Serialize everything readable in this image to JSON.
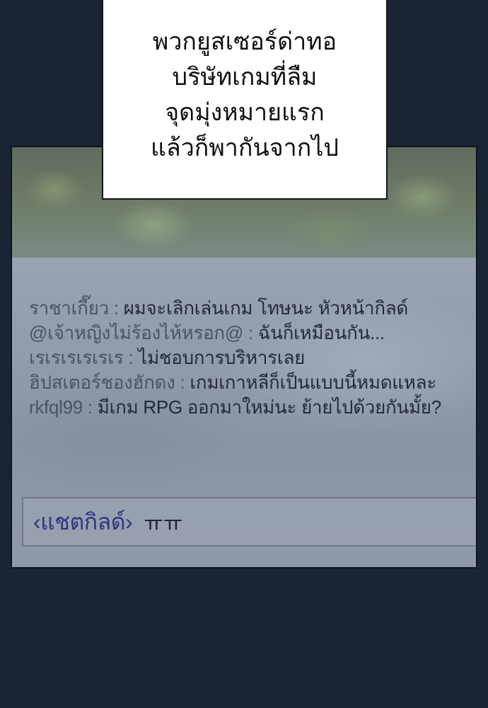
{
  "caption": {
    "lines": [
      "พวกยูสเซอร์ด่าทอ",
      "บริษัทเกมที่ลืม",
      "จุดมุ่งหมายแรก",
      "แล้วก็พากันจากไป"
    ]
  },
  "chat": {
    "lines": [
      {
        "user": "ราชาเกี๊ยว",
        "sep": " : ",
        "message": "ผมจะเลิกเล่นเกม โทษนะ หัวหน้ากิลด์"
      },
      {
        "user": "@เจ้าหญิงไม่ร้องไห้หรอก@",
        "sep": " : ",
        "message": "ฉันก็เหมือนกัน..."
      },
      {
        "user": "เรเรเรเรเรเร",
        "sep": " : ",
        "message": "ไม่ชอบการบริหารเลย"
      },
      {
        "user": "ฮิปสเตอร์ชองฮักดง",
        "sep": " : ",
        "message": "เกมเกาหลีก็เป็นแบบนี้หมดแหละ"
      },
      {
        "user": "rkfql99",
        "sep": " : ",
        "message": "มีเกม RPG ออกมาใหม่นะ ย้ายไปด้วยกันมั้ย?"
      }
    ],
    "input": {
      "channel": "‹แชตกิลด์›",
      "text": "ㅠㅠ"
    }
  },
  "colors": {
    "background": "#1b2432",
    "channel_label": "#2d3680"
  }
}
